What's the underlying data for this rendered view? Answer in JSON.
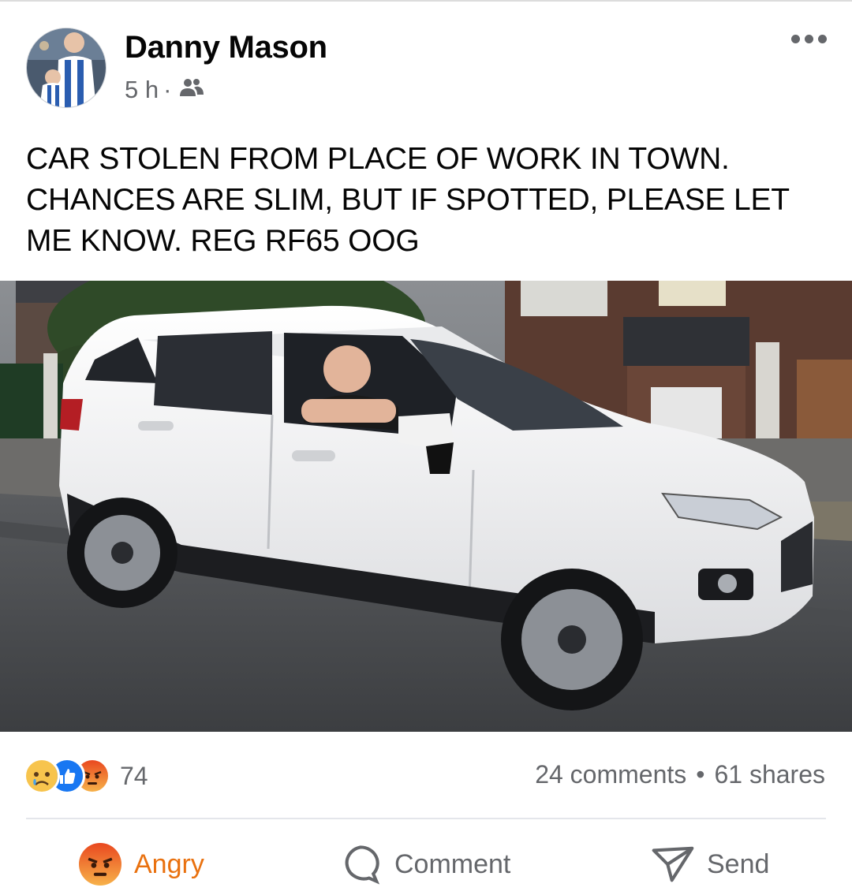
{
  "post": {
    "author": "Danny Mason",
    "time": "5 h",
    "time_separator": "·",
    "audience_icon": "friends-icon",
    "text": "CAR STOLEN FROM PLACE OF WORK IN TOWN.\nCHANCES ARE SLIM, BUT IF SPOTTED, PLEASE LET\nME KNOW. REG RF65 OOG"
  },
  "reactions": {
    "icons": [
      "sad-reaction-icon",
      "like-reaction-icon",
      "angry-reaction-icon"
    ],
    "count": "74"
  },
  "stats": {
    "comments": "24 comments",
    "separator": "•",
    "shares": "61 shares"
  },
  "actions": {
    "angry_label": "Angry",
    "comment_label": "Comment",
    "send_label": "Send"
  },
  "colors": {
    "angry_accent": "#e9710f",
    "secondary_text": "#65676b",
    "like_blue": "#1877f2"
  }
}
